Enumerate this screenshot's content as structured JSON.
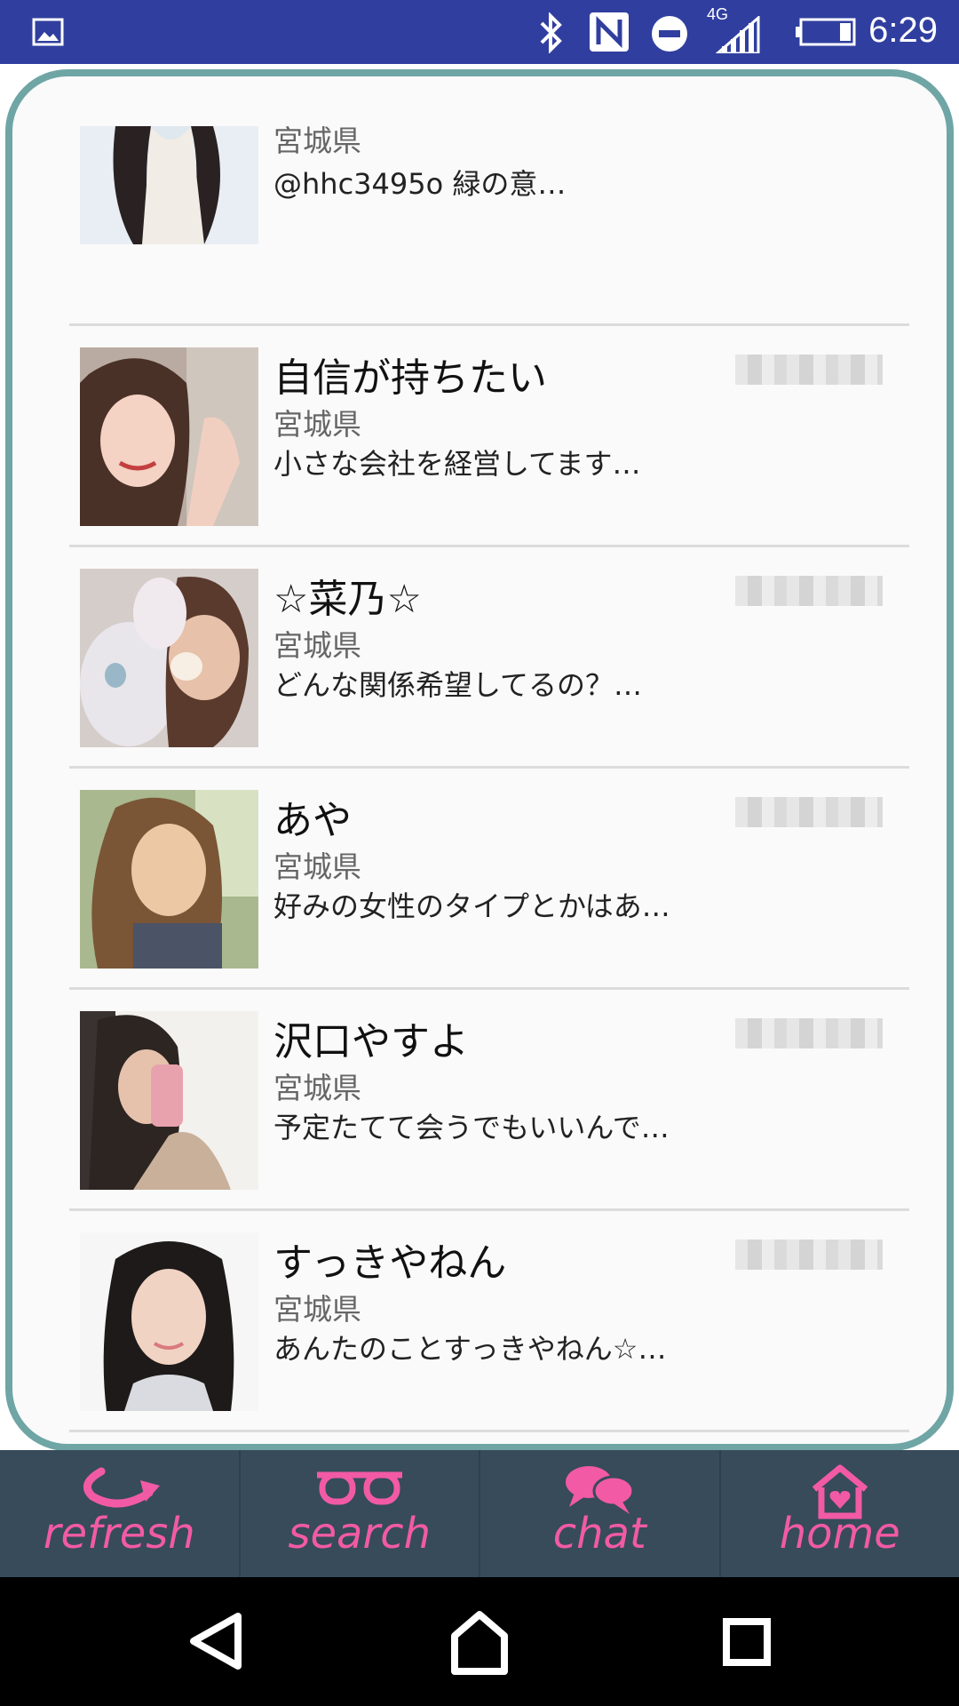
{
  "status_bar": {
    "time": "6:29",
    "network": "4G",
    "icons": [
      "image-icon",
      "bluetooth-icon",
      "nfc-icon",
      "do-not-disturb-icon",
      "signal-icon",
      "battery-icon"
    ]
  },
  "colors": {
    "status_bar": "#303F9F",
    "card_border": "#6fa5a5",
    "nav_bg": "#374b5a",
    "accent_pink": "#f25aa6"
  },
  "list": [
    {
      "name": "",
      "prefecture": "宮城県",
      "message": "@hhc3495o 緑の意…"
    },
    {
      "name": "自信が持ちたい",
      "prefecture": "宮城県",
      "message": "小さな会社を経営してます…"
    },
    {
      "name": "☆菜乃☆",
      "prefecture": "宮城県",
      "message": "どんな関係希望してるの？…"
    },
    {
      "name": "あや",
      "prefecture": "宮城県",
      "message": "好みの女性のタイプとかはあ…"
    },
    {
      "name": "沢口やすよ",
      "prefecture": "宮城県",
      "message": "予定たてて会うでもいいんで…"
    },
    {
      "name": "すっきやねん",
      "prefecture": "宮城県",
      "message": "あんたのことすっきやねん☆…"
    }
  ],
  "bottom_nav": {
    "refresh": "refresh",
    "search": "search",
    "chat": "chat",
    "home": "home"
  }
}
